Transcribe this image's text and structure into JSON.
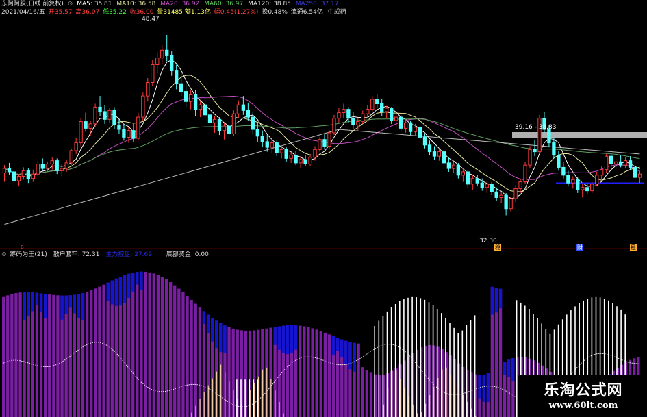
{
  "header": {
    "title": "东阿阿胶(日线 前复权)",
    "ma5": "MA5: 35.81",
    "ma10": "MA10: 36.58",
    "ma20": "MA20: 36.92",
    "ma60": "MA60: 36.97",
    "ma120": "MA120: 38.85",
    "ma250": "MA250: 37.17"
  },
  "info_row": {
    "date": "2021/04/16/五",
    "open": "开35.57",
    "high": "高36.07",
    "low": "低35.22",
    "close": "收36.00",
    "volume": "量31485",
    "amount": "额1.13亿",
    "change": "幅0.45(1.27%)",
    "turnover": "换0.48%",
    "float": "流通6.54亿",
    "category": "中成药"
  },
  "annotations": {
    "high_label": "48.47",
    "low_label": "32.30",
    "band_label": "39.16 - 38.83",
    "mark_left": "B",
    "mark_mid1": "稳",
    "mark_mid2": "财",
    "mark_right": "稳"
  },
  "indicator": {
    "title": "筹码为王(21)",
    "retail_label": "散户套牢: 72.31",
    "main_label": "主力控盘: 27.69",
    "bottom_label": "底部资金: 0.00"
  },
  "watermark": {
    "cn": "乐淘公式网",
    "url": "www.60lt.com"
  },
  "colors": {
    "up": "#ff3b3b",
    "down": "#54ffff",
    "ma5": "#ffffff",
    "ma10": "#e8e8a0",
    "ma20": "#c34fc3",
    "ma60": "#5fa05f",
    "ma120": "#dcdcdc",
    "purple_bar": "#7a1fa2",
    "blue_bar": "#1515d0",
    "white_bar": "#ffffff",
    "orange_bar": "#ffd8a8"
  },
  "chart_data": [
    {
      "type": "candlestick",
      "title": "东阿阿胶(日线 前复权)",
      "ylim": [
        30,
        50
      ],
      "ohlc_approx": [
        [
          36.1,
          36.8,
          35.3,
          36.5
        ],
        [
          36.5,
          37.0,
          35.9,
          36.2
        ],
        [
          36.2,
          36.4,
          35.0,
          35.4
        ],
        [
          35.4,
          36.0,
          34.9,
          35.8
        ],
        [
          35.8,
          36.6,
          35.5,
          36.3
        ],
        [
          36.3,
          36.5,
          35.2,
          35.6
        ],
        [
          35.6,
          36.4,
          35.3,
          36.0
        ],
        [
          36.0,
          37.2,
          35.8,
          36.9
        ],
        [
          36.9,
          37.4,
          36.3,
          36.5
        ],
        [
          36.5,
          37.1,
          36.2,
          36.9
        ],
        [
          36.9,
          37.5,
          36.4,
          37.2
        ],
        [
          37.2,
          37.4,
          36.0,
          36.3
        ],
        [
          36.3,
          36.9,
          35.8,
          36.5
        ],
        [
          36.5,
          37.3,
          36.2,
          37.0
        ],
        [
          37.0,
          38.3,
          36.8,
          38.1
        ],
        [
          38.1,
          39.2,
          37.8,
          38.8
        ],
        [
          38.8,
          41.0,
          38.5,
          40.7
        ],
        [
          40.7,
          41.5,
          39.8,
          40.1
        ],
        [
          40.1,
          40.8,
          39.4,
          40.5
        ],
        [
          40.5,
          42.3,
          40.2,
          42.0
        ],
        [
          42.0,
          43.0,
          41.2,
          41.6
        ],
        [
          41.6,
          42.2,
          40.5,
          40.9
        ],
        [
          40.9,
          41.9,
          40.6,
          41.7
        ],
        [
          41.7,
          42.0,
          40.0,
          40.4
        ],
        [
          40.4,
          40.9,
          39.6,
          40.0
        ],
        [
          40.0,
          40.5,
          39.0,
          39.3
        ],
        [
          39.3,
          40.2,
          38.8,
          39.9
        ],
        [
          39.9,
          40.5,
          38.9,
          39.2
        ],
        [
          39.2,
          41.5,
          39.0,
          41.1
        ],
        [
          41.1,
          43.3,
          40.8,
          43.0
        ],
        [
          43.0,
          44.6,
          42.5,
          44.2
        ],
        [
          44.2,
          46.2,
          43.9,
          45.8
        ],
        [
          45.8,
          46.9,
          45.0,
          46.4
        ],
        [
          46.4,
          47.6,
          45.8,
          47.1
        ],
        [
          47.1,
          48.47,
          46.1,
          46.6
        ],
        [
          46.6,
          47.0,
          44.8,
          45.3
        ],
        [
          45.3,
          45.8,
          43.6,
          44.1
        ],
        [
          44.1,
          45.0,
          43.0,
          43.4
        ],
        [
          43.4,
          44.2,
          42.0,
          42.5
        ],
        [
          42.5,
          43.5,
          41.8,
          43.1
        ],
        [
          43.1,
          43.5,
          41.2,
          41.8
        ],
        [
          41.8,
          42.6,
          41.1,
          42.2
        ],
        [
          42.2,
          42.6,
          40.8,
          41.3
        ],
        [
          41.3,
          41.8,
          40.2,
          40.6
        ],
        [
          40.6,
          41.2,
          39.7,
          40.9
        ],
        [
          40.9,
          41.1,
          39.5,
          39.9
        ],
        [
          39.9,
          40.6,
          39.1,
          40.3
        ],
        [
          40.3,
          40.7,
          39.2,
          39.6
        ],
        [
          39.6,
          41.7,
          39.4,
          41.4
        ],
        [
          41.4,
          42.6,
          41.0,
          42.2
        ],
        [
          42.2,
          43.0,
          41.3,
          41.7
        ],
        [
          41.7,
          42.4,
          40.8,
          41.1
        ],
        [
          41.1,
          41.6,
          39.6,
          40.0
        ],
        [
          40.0,
          40.6,
          38.9,
          39.4
        ],
        [
          39.4,
          39.9,
          38.4,
          38.9
        ],
        [
          38.9,
          39.5,
          38.0,
          38.4
        ],
        [
          38.4,
          39.2,
          37.9,
          38.8
        ],
        [
          38.8,
          39.0,
          37.6,
          37.9
        ],
        [
          37.9,
          38.6,
          37.4,
          38.2
        ],
        [
          38.2,
          38.4,
          37.1,
          37.4
        ],
        [
          37.4,
          38.0,
          37.0,
          37.7
        ],
        [
          37.7,
          38.1,
          36.8,
          37.0
        ],
        [
          37.0,
          37.6,
          36.5,
          37.3
        ],
        [
          37.3,
          37.7,
          36.7,
          36.9
        ],
        [
          36.9,
          37.8,
          36.7,
          37.5
        ],
        [
          37.5,
          38.5,
          37.2,
          38.2
        ],
        [
          38.2,
          39.3,
          38.0,
          39.1
        ],
        [
          39.1,
          39.6,
          38.2,
          38.5
        ],
        [
          38.5,
          39.9,
          38.3,
          39.7
        ],
        [
          39.7,
          41.3,
          39.5,
          41.0
        ],
        [
          41.0,
          41.9,
          40.6,
          41.5
        ],
        [
          41.5,
          42.3,
          41.0,
          41.8
        ],
        [
          41.8,
          42.0,
          40.6,
          41.0
        ],
        [
          41.0,
          41.6,
          40.0,
          40.4
        ],
        [
          40.4,
          41.0,
          39.9,
          40.7
        ],
        [
          40.7,
          41.7,
          40.5,
          41.4
        ],
        [
          41.4,
          42.2,
          41.0,
          41.8
        ],
        [
          41.8,
          43.0,
          41.6,
          42.7
        ],
        [
          42.7,
          43.2,
          41.9,
          42.3
        ],
        [
          42.3,
          42.7,
          41.2,
          41.6
        ],
        [
          41.6,
          42.1,
          41.0,
          41.9
        ],
        [
          41.9,
          42.0,
          40.5,
          40.8
        ],
        [
          40.8,
          41.4,
          40.2,
          41.1
        ],
        [
          41.1,
          41.3,
          39.8,
          40.1
        ],
        [
          40.1,
          40.9,
          39.7,
          40.6
        ],
        [
          40.6,
          40.8,
          39.5,
          39.8
        ],
        [
          39.8,
          40.5,
          39.4,
          40.2
        ],
        [
          40.2,
          40.4,
          39.0,
          39.3
        ],
        [
          39.3,
          39.6,
          38.3,
          38.6
        ],
        [
          38.6,
          39.0,
          37.7,
          38.0
        ],
        [
          38.0,
          38.5,
          37.3,
          37.6
        ],
        [
          37.6,
          38.3,
          37.2,
          38.0
        ],
        [
          38.0,
          38.2,
          36.8,
          37.0
        ],
        [
          37.0,
          37.5,
          36.2,
          36.5
        ],
        [
          36.5,
          37.1,
          36.1,
          36.8
        ],
        [
          36.8,
          37.0,
          35.6,
          35.9
        ],
        [
          35.9,
          36.5,
          35.3,
          36.2
        ],
        [
          36.2,
          36.4,
          34.8,
          35.1
        ],
        [
          35.1,
          35.9,
          34.6,
          35.6
        ],
        [
          35.6,
          35.9,
          34.9,
          35.2
        ],
        [
          35.2,
          35.6,
          34.5,
          34.8
        ],
        [
          34.8,
          35.4,
          34.3,
          35.1
        ],
        [
          35.1,
          35.3,
          34.1,
          34.4
        ],
        [
          34.4,
          34.8,
          33.6,
          33.9
        ],
        [
          33.9,
          34.4,
          33.4,
          34.1
        ],
        [
          34.1,
          34.3,
          32.3,
          32.9
        ],
        [
          32.9,
          34.0,
          32.6,
          33.8
        ],
        [
          33.8,
          35.0,
          33.5,
          34.7
        ],
        [
          34.7,
          35.6,
          34.3,
          35.3
        ],
        [
          35.3,
          37.1,
          35.1,
          36.8
        ],
        [
          36.8,
          38.5,
          36.5,
          38.2
        ],
        [
          38.2,
          39.1,
          37.6,
          38.0
        ],
        [
          38.0,
          41.3,
          37.8,
          41.0
        ],
        [
          41.0,
          41.6,
          39.7,
          40.0
        ],
        [
          40.0,
          40.4,
          38.4,
          38.8
        ],
        [
          38.8,
          39.3,
          37.4,
          37.7
        ],
        [
          37.7,
          38.1,
          36.3,
          36.6
        ],
        [
          36.6,
          37.1,
          35.6,
          35.9
        ],
        [
          35.9,
          36.3,
          34.9,
          35.2
        ],
        [
          35.2,
          35.8,
          34.7,
          35.5
        ],
        [
          35.5,
          35.7,
          34.3,
          34.6
        ],
        [
          34.6,
          35.1,
          33.9,
          34.8
        ],
        [
          34.8,
          35.2,
          34.2,
          34.5
        ],
        [
          34.5,
          35.3,
          34.3,
          35.1
        ],
        [
          35.1,
          36.2,
          34.9,
          35.9
        ],
        [
          35.9,
          36.7,
          35.5,
          36.4
        ],
        [
          36.4,
          37.8,
          36.1,
          37.6
        ],
        [
          37.6,
          37.9,
          36.6,
          36.9
        ],
        [
          36.9,
          37.4,
          36.4,
          37.1
        ],
        [
          37.1,
          37.7,
          36.6,
          36.8
        ],
        [
          36.8,
          37.5,
          36.5,
          37.2
        ],
        [
          37.2,
          37.6,
          36.4,
          36.6
        ],
        [
          36.6,
          36.9,
          35.4,
          35.7
        ],
        [
          35.7,
          36.3,
          35.2,
          36.0
        ]
      ],
      "series": [
        {
          "name": "MA5"
        },
        {
          "name": "MA10"
        },
        {
          "name": "MA20"
        },
        {
          "name": "MA60"
        },
        {
          "name": "MA120"
        }
      ]
    },
    {
      "type": "bar",
      "title": "筹码为王(21)",
      "ylim": [
        0,
        100
      ],
      "series": [
        {
          "name": "散户套牢"
        },
        {
          "name": "主力控盘"
        },
        {
          "name": "底部资金"
        }
      ]
    }
  ]
}
